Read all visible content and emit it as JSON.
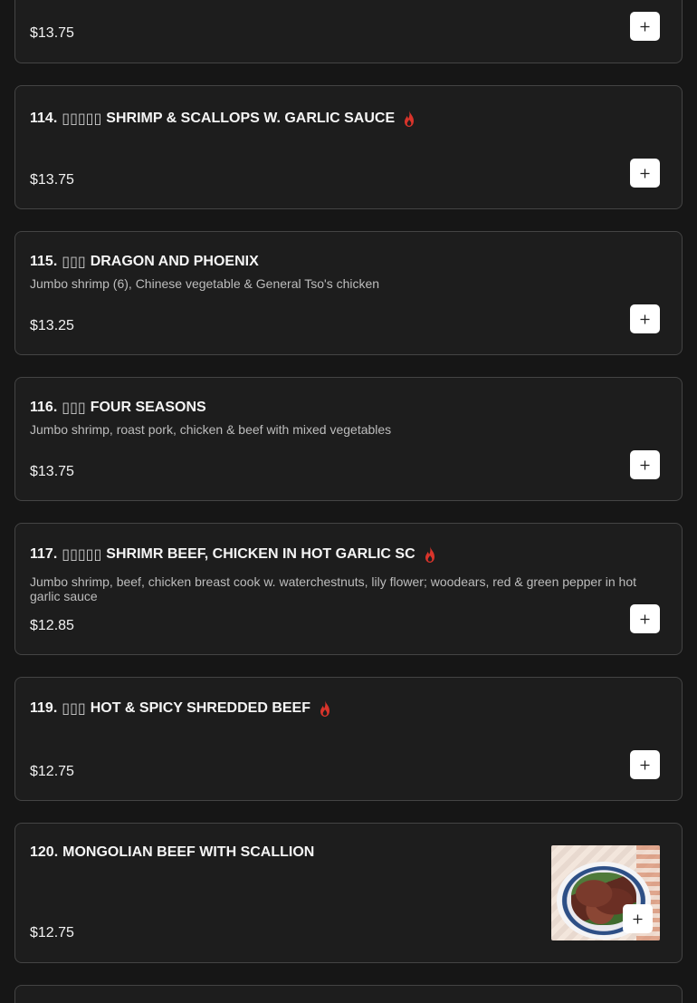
{
  "items": [
    {
      "number": "",
      "cjk": "",
      "name": "",
      "description": "",
      "price": "$13.75",
      "spicy": false
    },
    {
      "number": "114.",
      "cjk": "▯▯▯▯▯",
      "name": "SHRIMP & SCALLOPS W. GARLIC SAUCE",
      "description": "",
      "price": "$13.75",
      "spicy": true
    },
    {
      "number": "115.",
      "cjk": "▯▯▯",
      "name": "DRAGON AND PHOENIX",
      "description": "Jumbo shrimp (6), Chinese vegetable & General Tso's chicken",
      "price": "$13.25",
      "spicy": false
    },
    {
      "number": "116.",
      "cjk": "▯▯▯",
      "name": "FOUR SEASONS",
      "description": "Jumbo shrimp, roast pork, chicken & beef with mixed vegetables",
      "price": "$13.75",
      "spicy": false
    },
    {
      "number": "117.",
      "cjk": "▯▯▯▯▯",
      "name": "SHRIMR BEEF, CHICKEN IN HOT GARLIC SC",
      "description": "Jumbo shrimp, beef, chicken breast cook w. waterchestnuts, lily flower; woodears, red & green pepper in hot garlic sauce",
      "price": "$12.85",
      "spicy": true
    },
    {
      "number": "119.",
      "cjk": "▯▯▯",
      "name": "HOT & SPICY SHREDDED BEEF",
      "description": "",
      "price": "$12.75",
      "spicy": true
    },
    {
      "number": "120.",
      "cjk": "",
      "name": "MONGOLIAN BEEF WITH SCALLION",
      "description": "",
      "price": "$12.75",
      "spicy": false
    }
  ],
  "colors": {
    "spicy_icon": "#d9342b",
    "card_border": "#444444",
    "background": "#161616"
  },
  "icons": {
    "add": "plus-icon",
    "spicy": "flame-icon"
  }
}
